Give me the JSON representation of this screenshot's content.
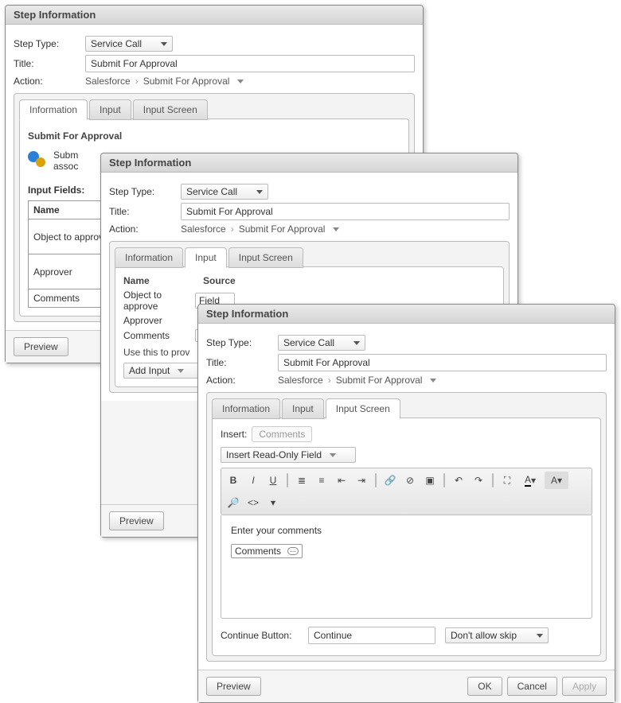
{
  "common": {
    "title": "Step Information",
    "stepTypeLabel": "Step Type:",
    "stepTypeValue": "Service Call",
    "titleLabel": "Title:",
    "titleValue": "Submit For Approval",
    "actionLabel": "Action:",
    "actionPath1": "Salesforce",
    "actionPath2": "Submit For Approval",
    "tabInformation": "Information",
    "tabInput": "Input",
    "tabInputScreen": "Input Screen",
    "previewLabel": "Preview",
    "okLabel": "OK",
    "cancelLabel": "Cancel",
    "applyLabel": "Apply"
  },
  "dialog1": {
    "sectionHeader": "Submit For Approval",
    "descStart": "Subm",
    "descLine2": "assoc",
    "inputFieldsLabel": "Input Fields:",
    "table": {
      "col1": "Name",
      "rows": [
        "Object to approve",
        "Approver",
        "Comments"
      ]
    }
  },
  "dialog2": {
    "colName": "Name",
    "colSource": "Source",
    "rows": {
      "r1": "Object to approve",
      "r2": "Approver",
      "r3": "Comments"
    },
    "hint": "Use this to prov",
    "addInput": "Add Input"
  },
  "dialog3": {
    "insertLabel": "Insert:",
    "insertPill": "Comments",
    "insertReadOnly": "Insert Read-Only Field",
    "editorLabel": "Enter your comments",
    "editorField": "Comments",
    "continueLabel": "Continue Button:",
    "continueValue": "Continue",
    "skipValue": "Don't allow skip"
  }
}
